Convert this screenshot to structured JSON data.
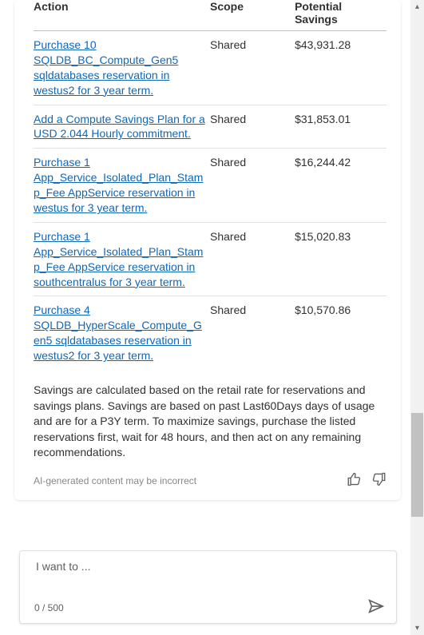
{
  "table": {
    "headers": {
      "action": "Action",
      "scope": "Scope",
      "savings": "Potential Savings"
    },
    "rows": [
      {
        "action": "Purchase 10 SQLDB_BC_Compute_Gen5 sqldatabases reservation in westus2 for 3 year term.",
        "scope": "Shared",
        "savings": "$43,931.28"
      },
      {
        "action": "Add a Compute Savings Plan for a USD 2.044 Hourly commitment.",
        "scope": "Shared",
        "savings": "$31,853.01"
      },
      {
        "action": "Purchase 1 App_Service_Isolated_Plan_Stamp_Fee AppService reservation in westus for 3 year term.",
        "scope": "Shared",
        "savings": "$16,244.42"
      },
      {
        "action": "Purchase 1 App_Service_Isolated_Plan_Stamp_Fee AppService reservation in southcentralus for 3 year term.",
        "scope": "Shared",
        "savings": "$15,020.83"
      },
      {
        "action": "Purchase 4 SQLDB_HyperScale_Compute_Gen5 sqldatabases reservation in westus2 for 3 year term.",
        "scope": "Shared",
        "savings": "$10,570.86"
      }
    ]
  },
  "footnote": "Savings are calculated based on the retail rate for reservations and savings plans. Savings are based on past Last60Days days of usage and are for a P3Y term. To maximize savings, purchase the listed reservations first, wait for 48 hours, and then act on any remaining recommendations.",
  "ai_disclaimer": "AI-generated content may be incorrect",
  "input": {
    "placeholder": "I want to ...",
    "counter": "0 / 500"
  }
}
